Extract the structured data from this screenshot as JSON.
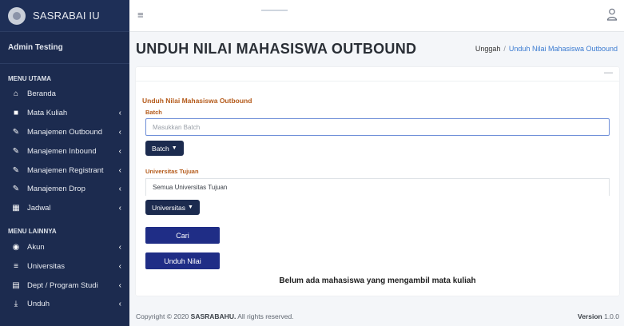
{
  "brand": {
    "name": "SASRABAI IU"
  },
  "user": {
    "name": "Admin Testing"
  },
  "menu": {
    "main_header": "MENU UTAMA",
    "main_items": [
      {
        "label": "Beranda",
        "icon": "home-icon",
        "glyph": "⌂",
        "caret": ""
      },
      {
        "label": "Mata Kuliah",
        "icon": "book-icon",
        "glyph": "■",
        "caret": "‹"
      },
      {
        "label": "Manajemen Outbound",
        "icon": "edit-icon",
        "glyph": "✎",
        "caret": "‹"
      },
      {
        "label": "Manajemen Inbound",
        "icon": "edit-icon",
        "glyph": "✎",
        "caret": "‹"
      },
      {
        "label": "Manajemen Registrant",
        "icon": "edit-icon",
        "glyph": "✎",
        "caret": "‹"
      },
      {
        "label": "Manajemen Drop",
        "icon": "edit-icon",
        "glyph": "✎",
        "caret": "‹"
      },
      {
        "label": "Jadwal",
        "icon": "calendar-icon",
        "glyph": "▦",
        "caret": "‹"
      }
    ],
    "other_header": "MENU LAINNYA",
    "other_items": [
      {
        "label": "Akun",
        "icon": "user-circle-icon",
        "glyph": "◉",
        "caret": "‹"
      },
      {
        "label": "Universitas",
        "icon": "university-icon",
        "glyph": "≡",
        "caret": "‹"
      },
      {
        "label": "Dept / Program Studi",
        "icon": "building-icon",
        "glyph": "▤",
        "caret": "‹"
      },
      {
        "label": "Unduh",
        "icon": "download-icon",
        "glyph": "⤓",
        "caret": "‹"
      }
    ]
  },
  "topbar": {
    "menu_glyph": "≡"
  },
  "page": {
    "title": "UNDUH NILAI MAHASISWA OUTBOUND",
    "breadcrumb_home": "Unggah",
    "breadcrumb_sep": "/",
    "breadcrumb_active": "Unduh Nilai Mahasiswa Outbound"
  },
  "card": {
    "collapse_glyph": "—",
    "section_title": "Unduh Nilai Mahasiswa Outbound",
    "batch_label": "Batch",
    "batch_placeholder": "Masukkan Batch",
    "batch_button": "Batch",
    "univ_label": "Universitas Tujuan",
    "univ_value": "Semua Universitas Tujuan",
    "univ_button": "Universitas",
    "caret": "▼",
    "search_button": "Cari",
    "download_button": "Unduh Nilai",
    "empty_message": "Belum ada mahasiswa yang mengambil mata kuliah"
  },
  "footer": {
    "copyright_prefix": "Copyright © 2020",
    "copyright_brand": "SASRABAHU.",
    "copyright_suffix": "All rights reserved.",
    "version_label": "Version",
    "version_number": "1.0.0"
  }
}
